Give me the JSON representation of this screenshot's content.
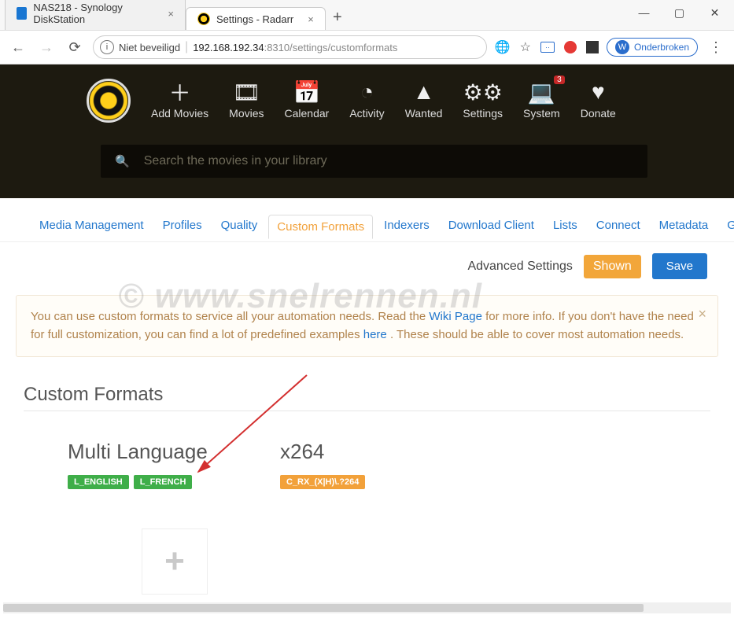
{
  "window": {
    "profile_initial": "W",
    "profile_label": "Onderbroken"
  },
  "tabs": [
    {
      "title": "NAS218 - Synology DiskStation",
      "active": false
    },
    {
      "title": "Settings - Radarr",
      "active": true
    }
  ],
  "addressbar": {
    "security_label": "Niet beveiligd",
    "host": "192.168.192.34",
    "port_path": ":8310/settings/customformats",
    "translate_label": "translate-icon"
  },
  "nav": {
    "items": [
      {
        "label": "Add Movies"
      },
      {
        "label": "Movies"
      },
      {
        "label": "Calendar"
      },
      {
        "label": "Activity"
      },
      {
        "label": "Wanted"
      },
      {
        "label": "Settings"
      },
      {
        "label": "System",
        "badge": "3"
      },
      {
        "label": "Donate"
      }
    ],
    "search_placeholder": "Search the movies in your library"
  },
  "subtabs": [
    "Media Management",
    "Profiles",
    "Quality",
    "Custom Formats",
    "Indexers",
    "Download Client",
    "Lists",
    "Connect",
    "Metadata",
    "Gen"
  ],
  "subtabs_active_index": 3,
  "toolbar": {
    "advanced_label": "Advanced Settings",
    "shown_label": "Shown",
    "save_label": "Save"
  },
  "info": {
    "text_1": "You can use custom formats to service all your automation needs. Read the ",
    "wiki_label": "Wiki Page",
    "text_2": " for more info. If you don't have the need for full customization, you can find a lot of predefined examples ",
    "here_label": "here",
    "text_3": ". These should be able to cover most automation needs."
  },
  "section": {
    "title": "Custom Formats"
  },
  "cards": [
    {
      "title": "Multi Language",
      "tags": [
        {
          "text": "L_ENGLISH",
          "cls": "green"
        },
        {
          "text": "L_FRENCH",
          "cls": "green"
        }
      ]
    },
    {
      "title": "x264",
      "tags": [
        {
          "text": "C_RX_(X|H)\\.?264",
          "cls": "orange"
        }
      ]
    }
  ],
  "watermark": "© www.snelrennen.nl"
}
